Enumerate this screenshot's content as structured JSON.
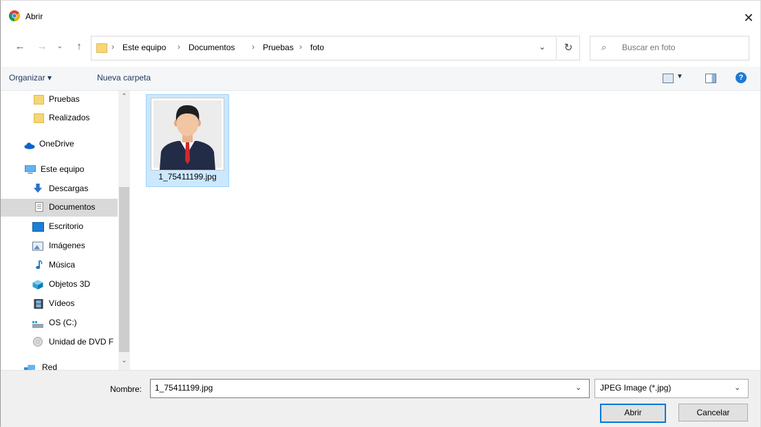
{
  "window": {
    "title": "Abrir",
    "close_icon": "close-icon"
  },
  "nav": {
    "back_icon": "back-arrow-icon",
    "forward_icon": "forward-arrow-icon",
    "recent_icon": "chevron-down-icon",
    "up_icon": "up-arrow-icon"
  },
  "address": {
    "breadcrumbs": [
      "Este equipo",
      "Documentos",
      "Pruebas",
      "foto"
    ],
    "separator": "›"
  },
  "search": {
    "placeholder": "Buscar en foto"
  },
  "toolbar": {
    "organizar": "Organizar ▾",
    "nueva_carpeta": "Nueva carpeta"
  },
  "sidebar": {
    "items": [
      {
        "label": "Pruebas",
        "icon": "folder-icon"
      },
      {
        "label": "Realizados",
        "icon": "folder-icon"
      },
      {
        "label": "OneDrive",
        "icon": "cloud-icon"
      },
      {
        "label": "Este equipo",
        "icon": "computer-icon"
      },
      {
        "label": "Descargas",
        "icon": "download-icon"
      },
      {
        "label": "Documentos",
        "icon": "document-icon",
        "selected": true
      },
      {
        "label": "Escritorio",
        "icon": "desktop-icon"
      },
      {
        "label": "Imágenes",
        "icon": "pictures-icon"
      },
      {
        "label": "Música",
        "icon": "music-icon"
      },
      {
        "label": "Objetos 3D",
        "icon": "cube-icon"
      },
      {
        "label": "Vídeos",
        "icon": "video-icon"
      },
      {
        "label": "OS (C:)",
        "icon": "drive-icon"
      },
      {
        "label": "Unidad de DVD F",
        "icon": "dvd-icon"
      },
      {
        "label": "Red",
        "icon": "network-icon"
      }
    ]
  },
  "files": [
    {
      "name": "1_75411199.jpg",
      "selected": true
    }
  ],
  "bottom": {
    "nombre_label": "Nombre:",
    "nombre_value": "1_75411199.jpg",
    "file_type": "JPEG Image (*.jpg)",
    "abrir": "Abrir",
    "cancelar": "Cancelar"
  },
  "colors": {
    "accent": "#0078d7",
    "selection": "#cce8ff",
    "folder": "#f6d775"
  }
}
